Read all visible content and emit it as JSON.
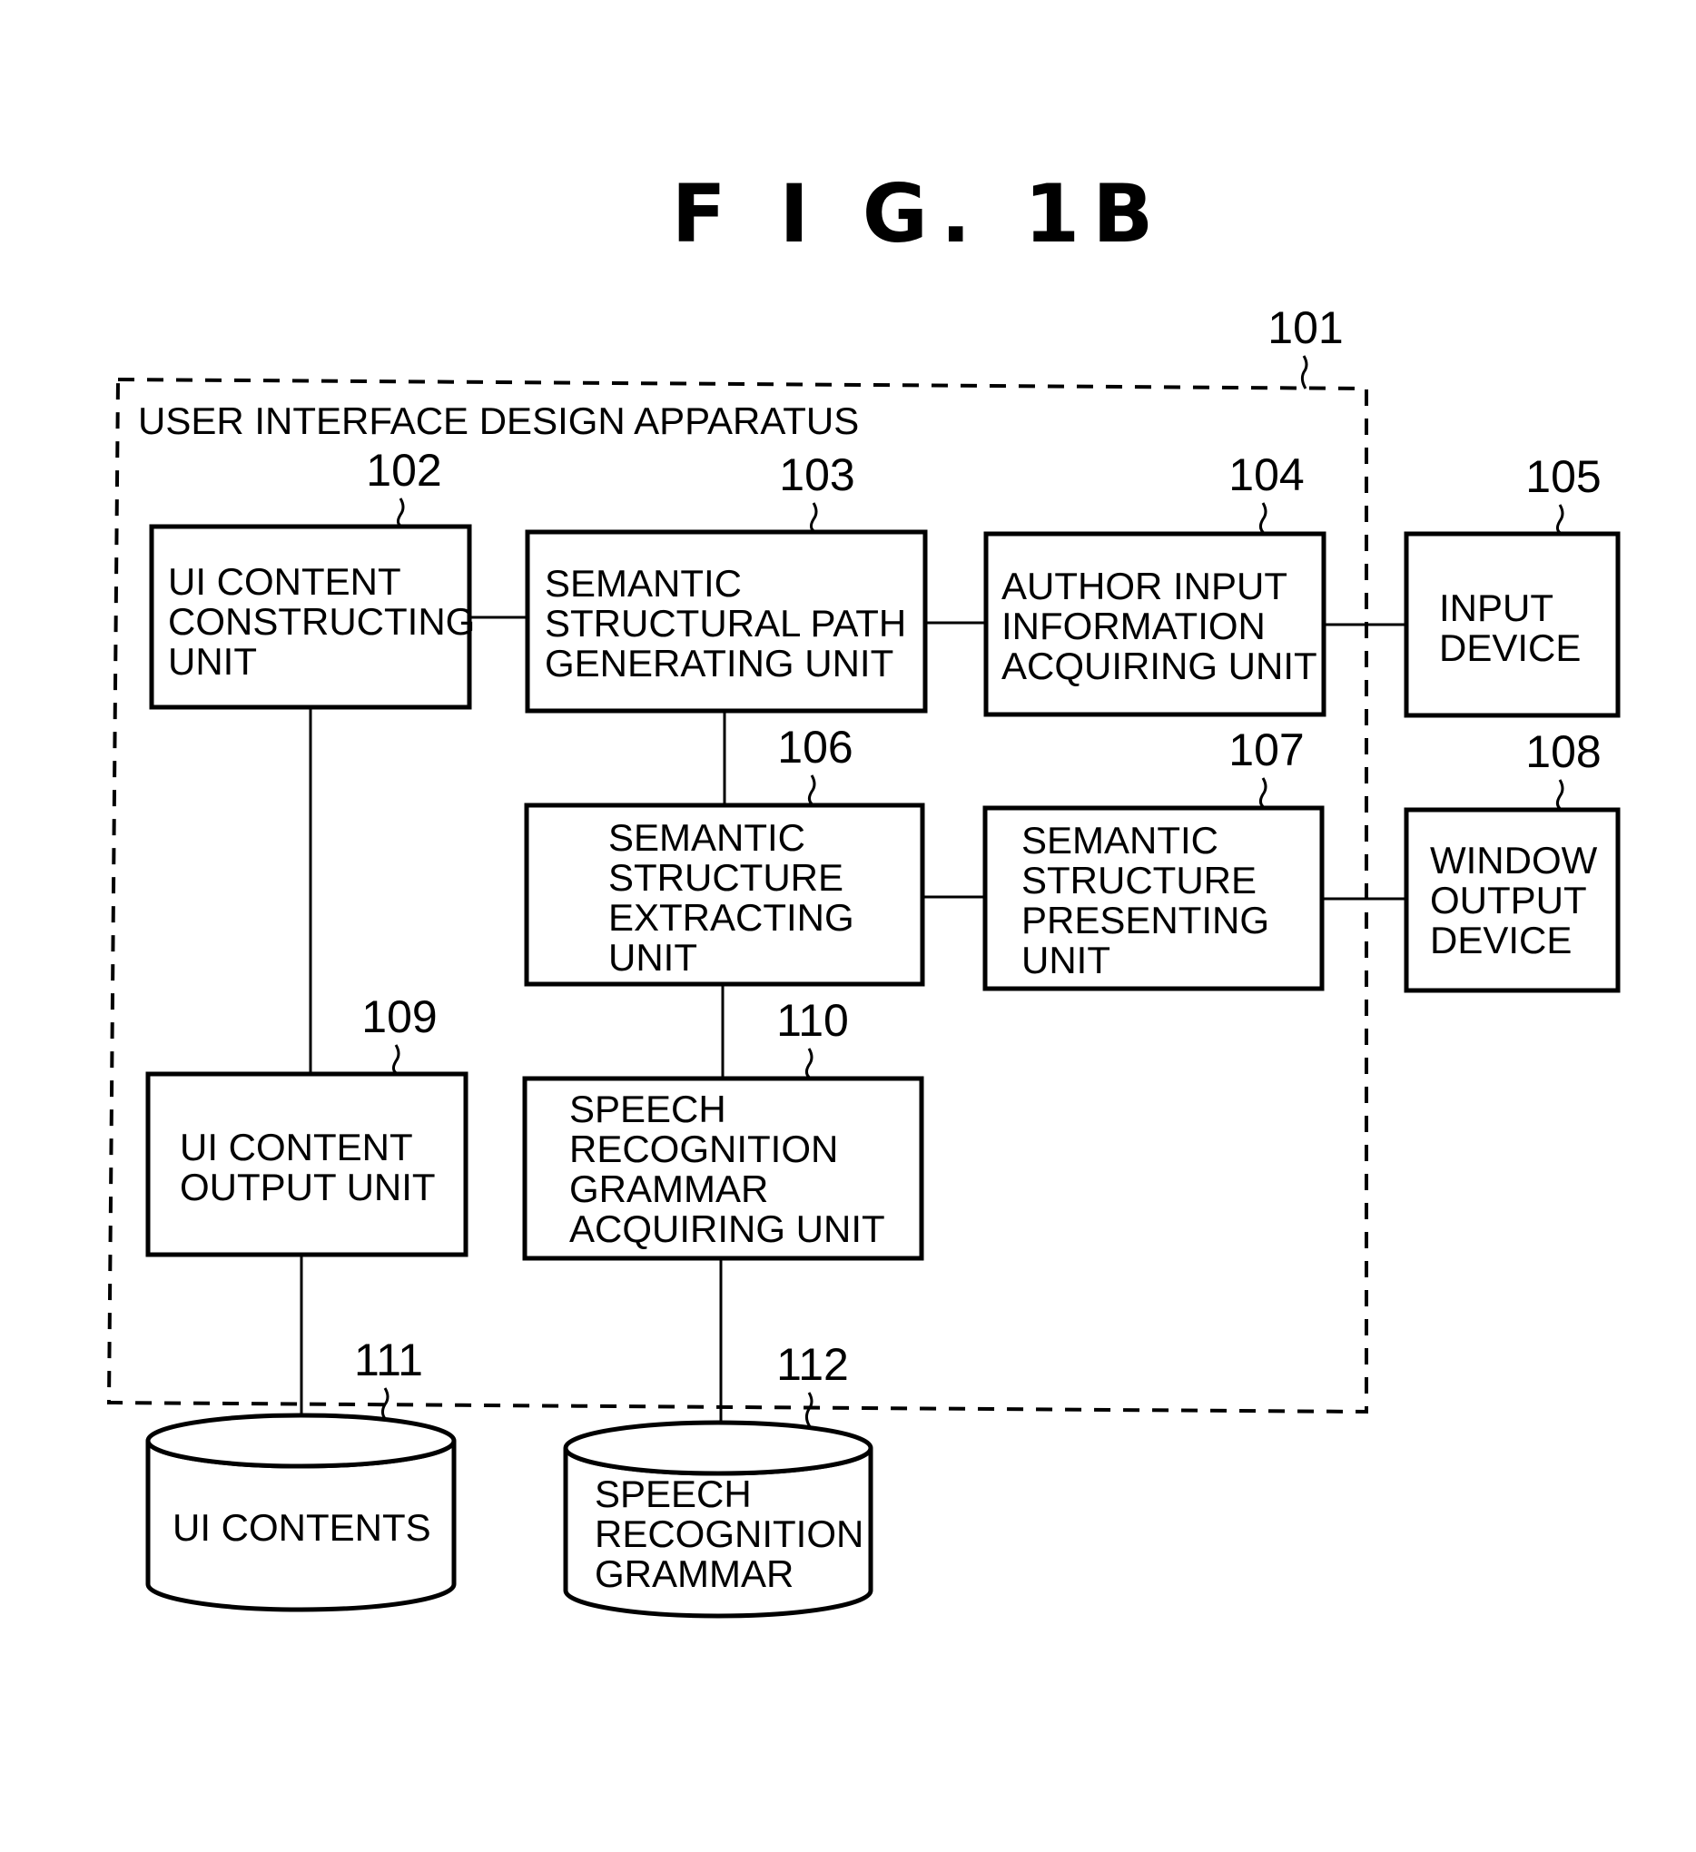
{
  "figure": {
    "title": "F I G.  1B"
  },
  "apparatus": {
    "ref": "101",
    "label": "USER INTERFACE DESIGN APPARATUS"
  },
  "blocks": [
    {
      "id": "102",
      "ref": "102",
      "lines": [
        "UI CONTENT",
        "CONSTRUCTING",
        "UNIT"
      ]
    },
    {
      "id": "103",
      "ref": "103",
      "lines": [
        "SEMANTIC",
        "STRUCTURAL PATH",
        "GENERATING UNIT"
      ]
    },
    {
      "id": "104",
      "ref": "104",
      "lines": [
        "AUTHOR INPUT",
        "INFORMATION",
        "ACQUIRING UNIT"
      ]
    },
    {
      "id": "105",
      "ref": "105",
      "lines": [
        "INPUT",
        "DEVICE"
      ]
    },
    {
      "id": "106",
      "ref": "106",
      "lines": [
        "SEMANTIC",
        "STRUCTURE",
        "EXTRACTING",
        "UNIT"
      ]
    },
    {
      "id": "107",
      "ref": "107",
      "lines": [
        "SEMANTIC",
        "STRUCTURE",
        "PRESENTING",
        "UNIT"
      ]
    },
    {
      "id": "108",
      "ref": "108",
      "lines": [
        "WINDOW",
        "OUTPUT",
        "DEVICE"
      ]
    },
    {
      "id": "109",
      "ref": "109",
      "lines": [
        "UI CONTENT",
        "OUTPUT UNIT"
      ]
    },
    {
      "id": "110",
      "ref": "110",
      "lines": [
        "SPEECH",
        "RECOGNITION",
        "GRAMMAR",
        "ACQUIRING UNIT"
      ]
    }
  ],
  "stores": [
    {
      "id": "111",
      "ref": "111",
      "lines": [
        "UI CONTENTS"
      ]
    },
    {
      "id": "112",
      "ref": "112",
      "lines": [
        "SPEECH",
        "RECOGNITION",
        "GRAMMAR"
      ]
    }
  ],
  "connections": [
    {
      "from": "102",
      "to": "103"
    },
    {
      "from": "103",
      "to": "104"
    },
    {
      "from": "104",
      "to": "105"
    },
    {
      "from": "103",
      "to": "106"
    },
    {
      "from": "106",
      "to": "107"
    },
    {
      "from": "107",
      "to": "108"
    },
    {
      "from": "102",
      "to": "109"
    },
    {
      "from": "106",
      "to": "110"
    },
    {
      "from": "109",
      "to": "111"
    },
    {
      "from": "110",
      "to": "112"
    }
  ]
}
